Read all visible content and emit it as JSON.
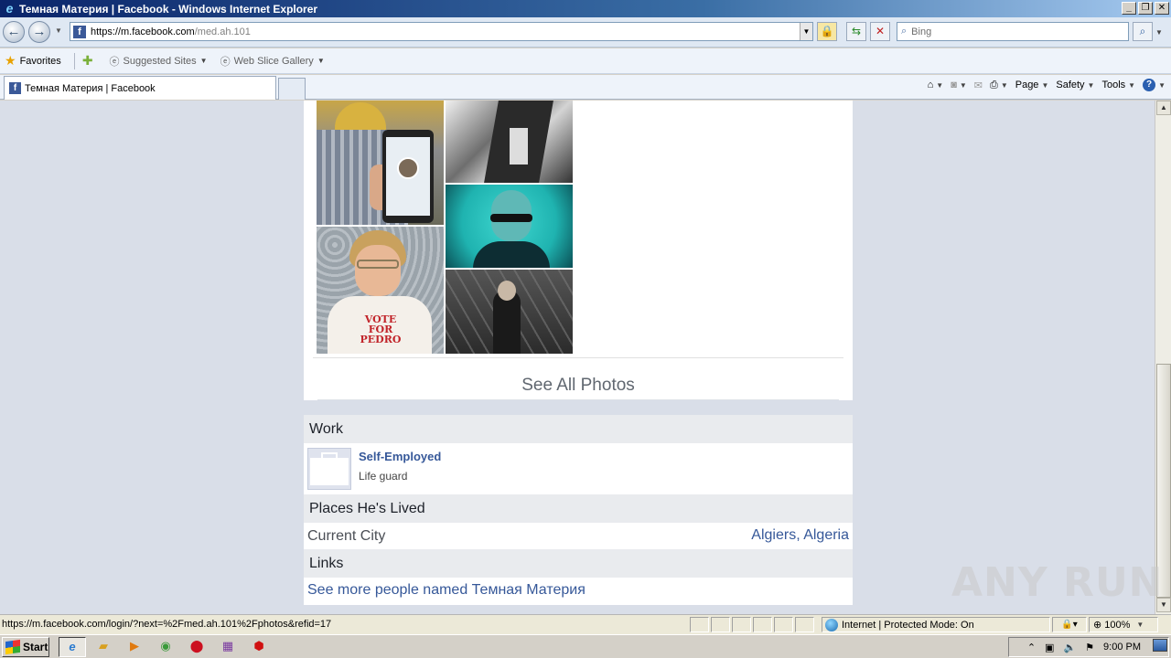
{
  "window": {
    "title": "Темная Материя | Facebook - Windows Internet Explorer",
    "min": "_",
    "max": "❐",
    "close": "✕"
  },
  "address": {
    "url_domain": "https://m.facebook.com",
    "url_path": "/med.ah.101",
    "search_placeholder": "Bing"
  },
  "favorites": {
    "label": "Favorites",
    "items": [
      {
        "label": "Suggested Sites"
      },
      {
        "label": "Web Slice Gallery"
      }
    ]
  },
  "tab": {
    "label": "Темная Материя | Facebook"
  },
  "commandbar": {
    "page": "Page",
    "safety": "Safety",
    "tools": "Tools",
    "help": "?"
  },
  "photos": {
    "tee_text": "VOTE FOR PEDRO",
    "see_all": "See All Photos"
  },
  "work": {
    "heading": "Work",
    "employer": "Self-Employed",
    "position": "Life guard"
  },
  "places": {
    "heading": "Places He's Lived",
    "label": "Current City",
    "value": "Algiers, Algeria"
  },
  "links": {
    "heading": "Links",
    "more_people": "See more people named Темная Материя"
  },
  "status": {
    "url": "https://m.facebook.com/login/?next=%2Fmed.ah.101%2Fphotos&refid=17",
    "zone": "Internet | Protected Mode: On",
    "zoom": "100%"
  },
  "taskbar": {
    "start": "Start",
    "clock": "9:00 PM"
  },
  "watermark": "ANY RUN"
}
